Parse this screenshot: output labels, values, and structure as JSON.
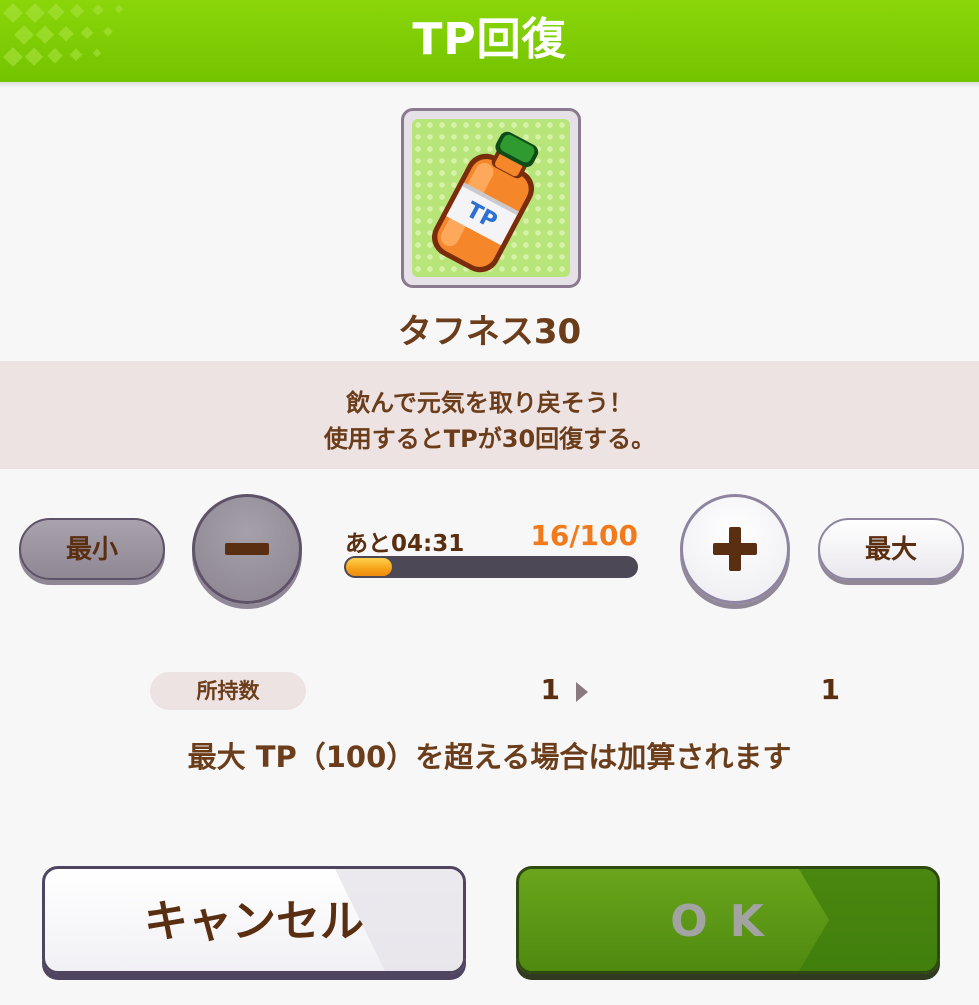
{
  "header": {
    "title": "TP回復"
  },
  "item": {
    "name": "タフネス30",
    "icon": "tp-bottle-icon",
    "bottle_label": "TP"
  },
  "description": {
    "line1": "飲んで元気を取り戻そう！",
    "line2": "使用するとTPが30回復する。"
  },
  "controls": {
    "min_label": "最小",
    "max_label": "最大",
    "minus_icon": "minus-icon",
    "plus_icon": "plus-icon"
  },
  "tp": {
    "timer": "あと04:31",
    "value": "16/100",
    "current": 16,
    "max": 100
  },
  "possession": {
    "label": "所持数",
    "before": "1",
    "after": "1",
    "arrow_icon": "arrow-right-icon"
  },
  "note": "最大 TP（100）を超える場合は加算されます",
  "buttons": {
    "cancel": "キャンセル",
    "ok": "OK"
  },
  "colors": {
    "header_green": "#7ccc00",
    "text_brown": "#6b3d1a",
    "tp_orange": "#f07a1c",
    "ok_green": "#5a981a"
  }
}
